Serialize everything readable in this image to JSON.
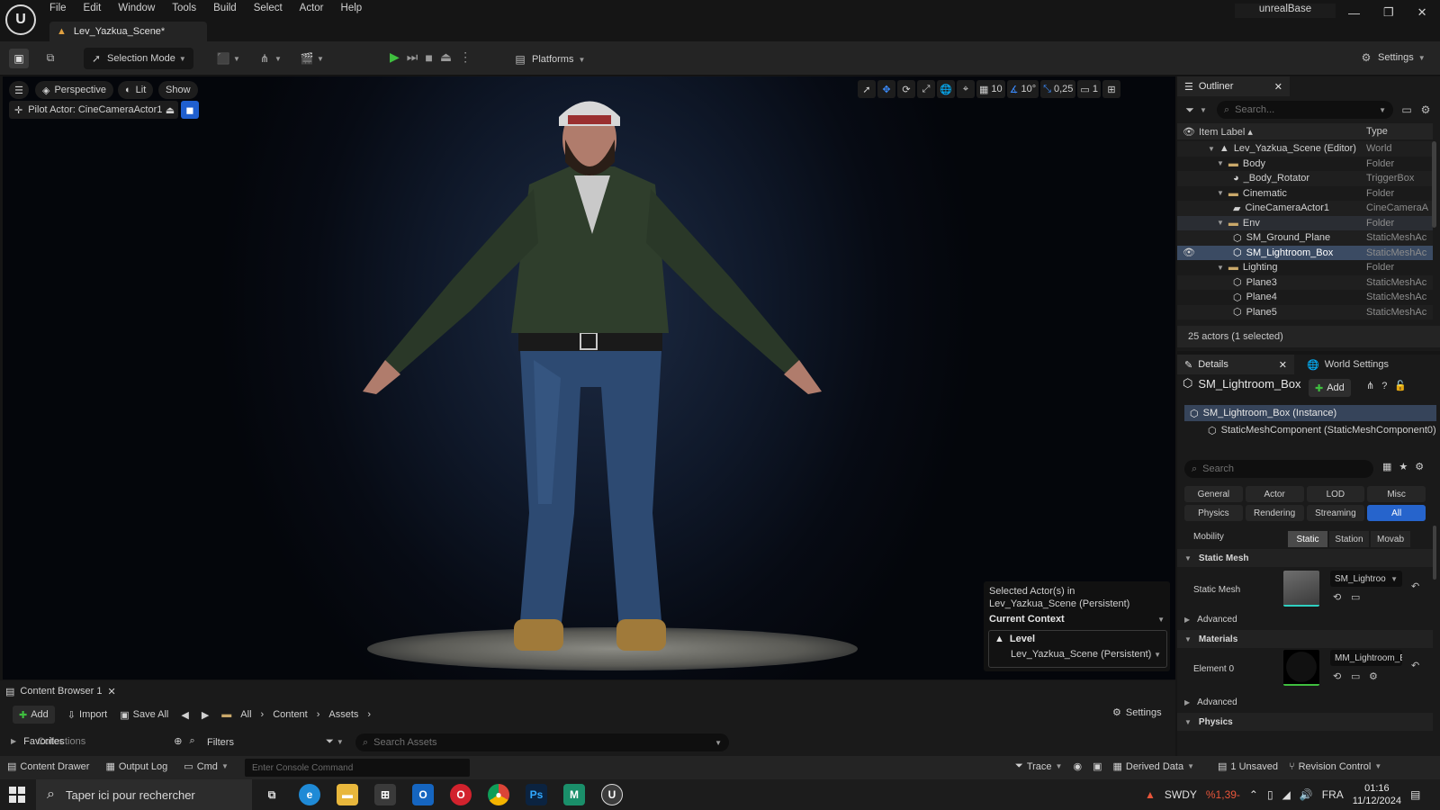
{
  "window": {
    "project_name": "unrealBase",
    "document_tab": "Lev_Yazkua_Scene*",
    "menu": [
      "File",
      "Edit",
      "Window",
      "Tools",
      "Build",
      "Select",
      "Actor",
      "Help"
    ]
  },
  "toolbar": {
    "selection_mode": "Selection Mode",
    "platforms": "Platforms",
    "settings": "Settings"
  },
  "viewport": {
    "perspective": "Perspective",
    "lit": "Lit",
    "show": "Show",
    "pilot_actor": "Pilot Actor: CineCameraActor1",
    "grid_snap": "10",
    "rotation_snap": "10°",
    "scale_snap": "0,25",
    "camera_speed": "1"
  },
  "context_popup": {
    "line1": "Selected Actor(s) in",
    "line2": "Lev_Yazkua_Scene (Persistent)",
    "current_context": "Current Context",
    "level_label": "Level",
    "level_value": "Lev_Yazkua_Scene (Persistent)"
  },
  "outliner": {
    "title": "Outliner",
    "search_placeholder": "Search...",
    "col_label": "Item Label ▴",
    "col_type": "Type",
    "items": [
      {
        "label": "Lev_Yazkua_Scene (Editor)",
        "type": "World",
        "icon": "world-icon"
      },
      {
        "label": "Body",
        "type": "Folder",
        "icon": "folder-icon"
      },
      {
        "label": "_Body_Rotator",
        "type": "TriggerBox",
        "icon": "trigger-icon"
      },
      {
        "label": "Cinematic",
        "type": "Folder",
        "icon": "folder-icon"
      },
      {
        "label": "CineCameraActor1",
        "type": "CineCameraA",
        "icon": "camera-icon"
      },
      {
        "label": "Env",
        "type": "Folder",
        "icon": "folder-icon"
      },
      {
        "label": "SM_Ground_Plane",
        "type": "StaticMeshAc",
        "icon": "mesh-icon"
      },
      {
        "label": "SM_Lightroom_Box",
        "type": "StaticMeshAc",
        "icon": "mesh-icon"
      },
      {
        "label": "Lighting",
        "type": "Folder",
        "icon": "folder-icon"
      },
      {
        "label": "Plane3",
        "type": "StaticMeshAc",
        "icon": "mesh-icon"
      },
      {
        "label": "Plane4",
        "type": "StaticMeshAc",
        "icon": "mesh-icon"
      },
      {
        "label": "Plane5",
        "type": "StaticMeshAc",
        "icon": "mesh-icon"
      }
    ],
    "status": "25 actors (1 selected)"
  },
  "details": {
    "tab": "Details",
    "world_settings_tab": "World Settings",
    "actor_name": "SM_Lightroom_Box",
    "add_label": "Add",
    "instance_label": "SM_Lightroom_Box (Instance)",
    "component_label": "StaticMeshComponent (StaticMeshComponent0)",
    "search_placeholder": "Search",
    "filters": [
      "General",
      "Actor",
      "LOD",
      "Misc",
      "Physics",
      "Rendering",
      "Streaming",
      "All"
    ],
    "active_filter": "All",
    "mobility_label": "Mobility",
    "mobility_options": [
      "Static",
      "Station",
      "Movab"
    ],
    "mobility_selected": "Static",
    "static_mesh_section": "Static Mesh",
    "static_mesh_label": "Static Mesh",
    "static_mesh_value": "SM_Lightroo",
    "advanced_label": "Advanced",
    "materials_section": "Materials",
    "element0_label": "Element 0",
    "element0_value": "MM_Lightroom_Bo",
    "advanced_label_2": "Advanced",
    "physics_section": "Physics"
  },
  "content_browser": {
    "tab": "Content Browser 1",
    "add": "Add",
    "import": "Import",
    "save_all": "Save All",
    "breadcrumbs": [
      "All",
      "Content",
      "Assets"
    ],
    "settings": "Settings",
    "favorites": "Favorites",
    "collections": "Collections",
    "filters": "Filters",
    "search_placeholder": "Search Assets"
  },
  "status_bar": {
    "content_drawer": "Content Drawer",
    "output_log": "Output Log",
    "cmd": "Cmd",
    "console_placeholder": "Enter Console Command",
    "trace": "Trace",
    "derived_data": "Derived Data",
    "unsaved": "1 Unsaved",
    "revision_control": "Revision Control"
  },
  "taskbar": {
    "search_placeholder": "Taper ici pour rechercher",
    "ticker": "SWDY",
    "ticker_change": "%1,39-",
    "language": "FRA",
    "time": "01:16",
    "date": "11/12/2024"
  },
  "colors": {
    "accent_blue": "#2664cc",
    "selection": "#3b4b63",
    "play_green": "#3fbf3f"
  }
}
